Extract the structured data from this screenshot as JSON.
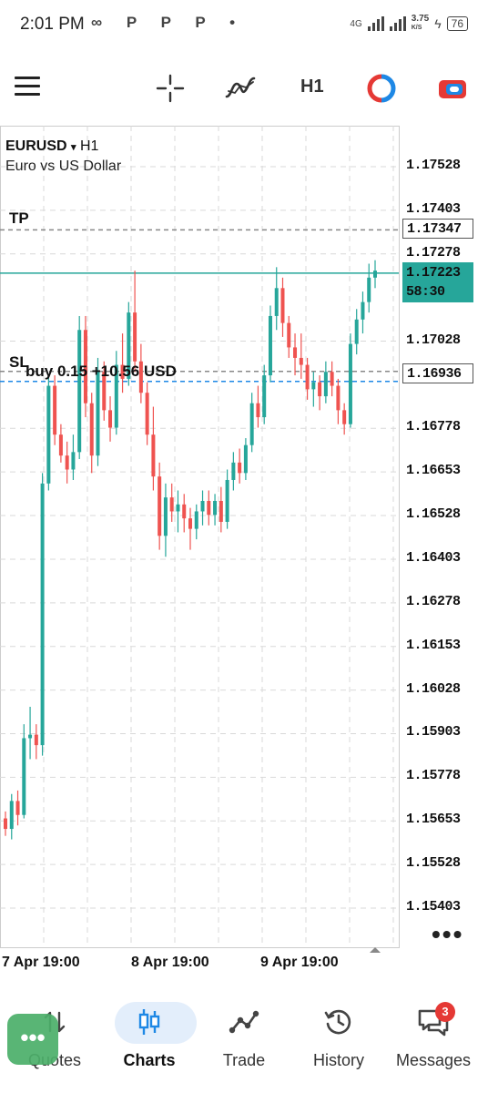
{
  "status_bar": {
    "time": "2:01 PM",
    "left_icons": "∞ P P P •",
    "network": "4G",
    "speed_value": "3.75",
    "speed_unit": "K/S",
    "battery": "76"
  },
  "toolbar": {
    "timeframe": "H1",
    "icons": [
      "menu-icon",
      "crosshair-icon",
      "indicator-icon",
      "one-click-trading-icon",
      "account-icon"
    ]
  },
  "chart": {
    "symbol": "EURUSD",
    "timeframe_caret": "▾",
    "timeframe": "H1",
    "description": "Euro vs US Dollar",
    "tp_label": "TP",
    "sl_label": "SL",
    "trade_label": "buy 0.15   +10.56 USD",
    "tp_price": "1.17347",
    "bid_price": "1.17223",
    "bar_countdown": "58:30",
    "sl_price": "1.16936",
    "more_label": "•••",
    "price_axis": [
      "1.17528",
      "1.17403",
      "1.17278",
      "1.17028",
      "1.16778",
      "1.16653",
      "1.16528",
      "1.16403",
      "1.16278",
      "1.16153",
      "1.16028",
      "1.15903",
      "1.15778",
      "1.15653",
      "1.15528",
      "1.15403"
    ],
    "time_axis": [
      "7 Apr 19:00",
      "8 Apr 19:00",
      "9 Apr 19:00"
    ],
    "colors": {
      "bull": "#26a69a",
      "bear": "#ef5350",
      "grid": "#d9d9d9",
      "tp_line": "#888888",
      "bid_line": "#26a69a",
      "entry_line": "#1e88e5"
    }
  },
  "chart_data": {
    "type": "candlestick",
    "symbol": "EURUSD",
    "timeframe": "H1",
    "ylim": [
      1.1534,
      1.1765
    ],
    "levels": {
      "tp": 1.17347,
      "bid": 1.17223,
      "sl": 1.16936
    },
    "candles": [
      [
        1.1566,
        1.1568,
        1.1561,
        1.1563
      ],
      [
        1.1563,
        1.1573,
        1.156,
        1.1571
      ],
      [
        1.1571,
        1.1574,
        1.1564,
        1.1567
      ],
      [
        1.1567,
        1.1593,
        1.1566,
        1.1589
      ],
      [
        1.1589,
        1.1598,
        1.1583,
        1.159
      ],
      [
        1.159,
        1.1593,
        1.1583,
        1.1587
      ],
      [
        1.1587,
        1.1665,
        1.1584,
        1.1662
      ],
      [
        1.1662,
        1.1693,
        1.166,
        1.169
      ],
      [
        1.169,
        1.1693,
        1.1673,
        1.1676
      ],
      [
        1.1676,
        1.1679,
        1.1668,
        1.167
      ],
      [
        1.167,
        1.1674,
        1.1662,
        1.1666
      ],
      [
        1.1666,
        1.1676,
        1.1663,
        1.1671
      ],
      [
        1.1671,
        1.171,
        1.1669,
        1.1706
      ],
      [
        1.1706,
        1.171,
        1.1681,
        1.1685
      ],
      [
        1.1685,
        1.1688,
        1.1665,
        1.167
      ],
      [
        1.167,
        1.1698,
        1.1667,
        1.1694
      ],
      [
        1.1694,
        1.1697,
        1.168,
        1.1683
      ],
      [
        1.1683,
        1.1687,
        1.1674,
        1.1678
      ],
      [
        1.1678,
        1.17,
        1.1676,
        1.1696
      ],
      [
        1.1696,
        1.1705,
        1.1688,
        1.1692
      ],
      [
        1.1692,
        1.1714,
        1.169,
        1.1711
      ],
      [
        1.1711,
        1.1723,
        1.1694,
        1.1697
      ],
      [
        1.1697,
        1.1702,
        1.1685,
        1.1688
      ],
      [
        1.1688,
        1.1691,
        1.1673,
        1.1676
      ],
      [
        1.1676,
        1.1684,
        1.166,
        1.1664
      ],
      [
        1.1664,
        1.1668,
        1.1643,
        1.1647
      ],
      [
        1.1647,
        1.1662,
        1.1641,
        1.1658
      ],
      [
        1.1658,
        1.1662,
        1.1651,
        1.1654
      ],
      [
        1.1654,
        1.166,
        1.1648,
        1.1656
      ],
      [
        1.1656,
        1.1659,
        1.1648,
        1.1652
      ],
      [
        1.1652,
        1.1655,
        1.1643,
        1.1649
      ],
      [
        1.1649,
        1.1656,
        1.1646,
        1.1654
      ],
      [
        1.1654,
        1.166,
        1.165,
        1.1657
      ],
      [
        1.1657,
        1.166,
        1.165,
        1.1653
      ],
      [
        1.1653,
        1.1659,
        1.165,
        1.1657
      ],
      [
        1.1657,
        1.1661,
        1.1648,
        1.1651
      ],
      [
        1.1651,
        1.1666,
        1.1649,
        1.1663
      ],
      [
        1.1663,
        1.1671,
        1.166,
        1.1668
      ],
      [
        1.1668,
        1.1672,
        1.1662,
        1.1665
      ],
      [
        1.1665,
        1.1675,
        1.1663,
        1.1673
      ],
      [
        1.1673,
        1.1688,
        1.1671,
        1.1685
      ],
      [
        1.1685,
        1.169,
        1.1678,
        1.1681
      ],
      [
        1.1681,
        1.1696,
        1.1679,
        1.1693
      ],
      [
        1.1693,
        1.1713,
        1.1691,
        1.171
      ],
      [
        1.171,
        1.1724,
        1.1706,
        1.1718
      ],
      [
        1.1718,
        1.1721,
        1.1704,
        1.1708
      ],
      [
        1.1708,
        1.171,
        1.1698,
        1.1701
      ],
      [
        1.1701,
        1.1705,
        1.1693,
        1.1698
      ],
      [
        1.1698,
        1.1705,
        1.1692,
        1.1696
      ],
      [
        1.1696,
        1.1698,
        1.1686,
        1.1689
      ],
      [
        1.1689,
        1.1694,
        1.1684,
        1.1691
      ],
      [
        1.1691,
        1.1693,
        1.1683,
        1.1687
      ],
      [
        1.1687,
        1.1697,
        1.1685,
        1.1694
      ],
      [
        1.1694,
        1.1697,
        1.1687,
        1.169
      ],
      [
        1.169,
        1.1692,
        1.1679,
        1.1683
      ],
      [
        1.1683,
        1.1685,
        1.1676,
        1.1679
      ],
      [
        1.1679,
        1.1705,
        1.1678,
        1.1702
      ],
      [
        1.1702,
        1.1712,
        1.1699,
        1.1709
      ],
      [
        1.1709,
        1.1717,
        1.1705,
        1.1714
      ],
      [
        1.1714,
        1.1725,
        1.1711,
        1.1721
      ],
      [
        1.1721,
        1.1726,
        1.1718,
        1.1723
      ]
    ]
  },
  "bottom_nav": {
    "items": [
      {
        "label": "Quotes"
      },
      {
        "label": "Charts"
      },
      {
        "label": "Trade"
      },
      {
        "label": "History"
      },
      {
        "label": "Messages"
      }
    ],
    "messages_badge": "3",
    "fab_label": "•••"
  }
}
